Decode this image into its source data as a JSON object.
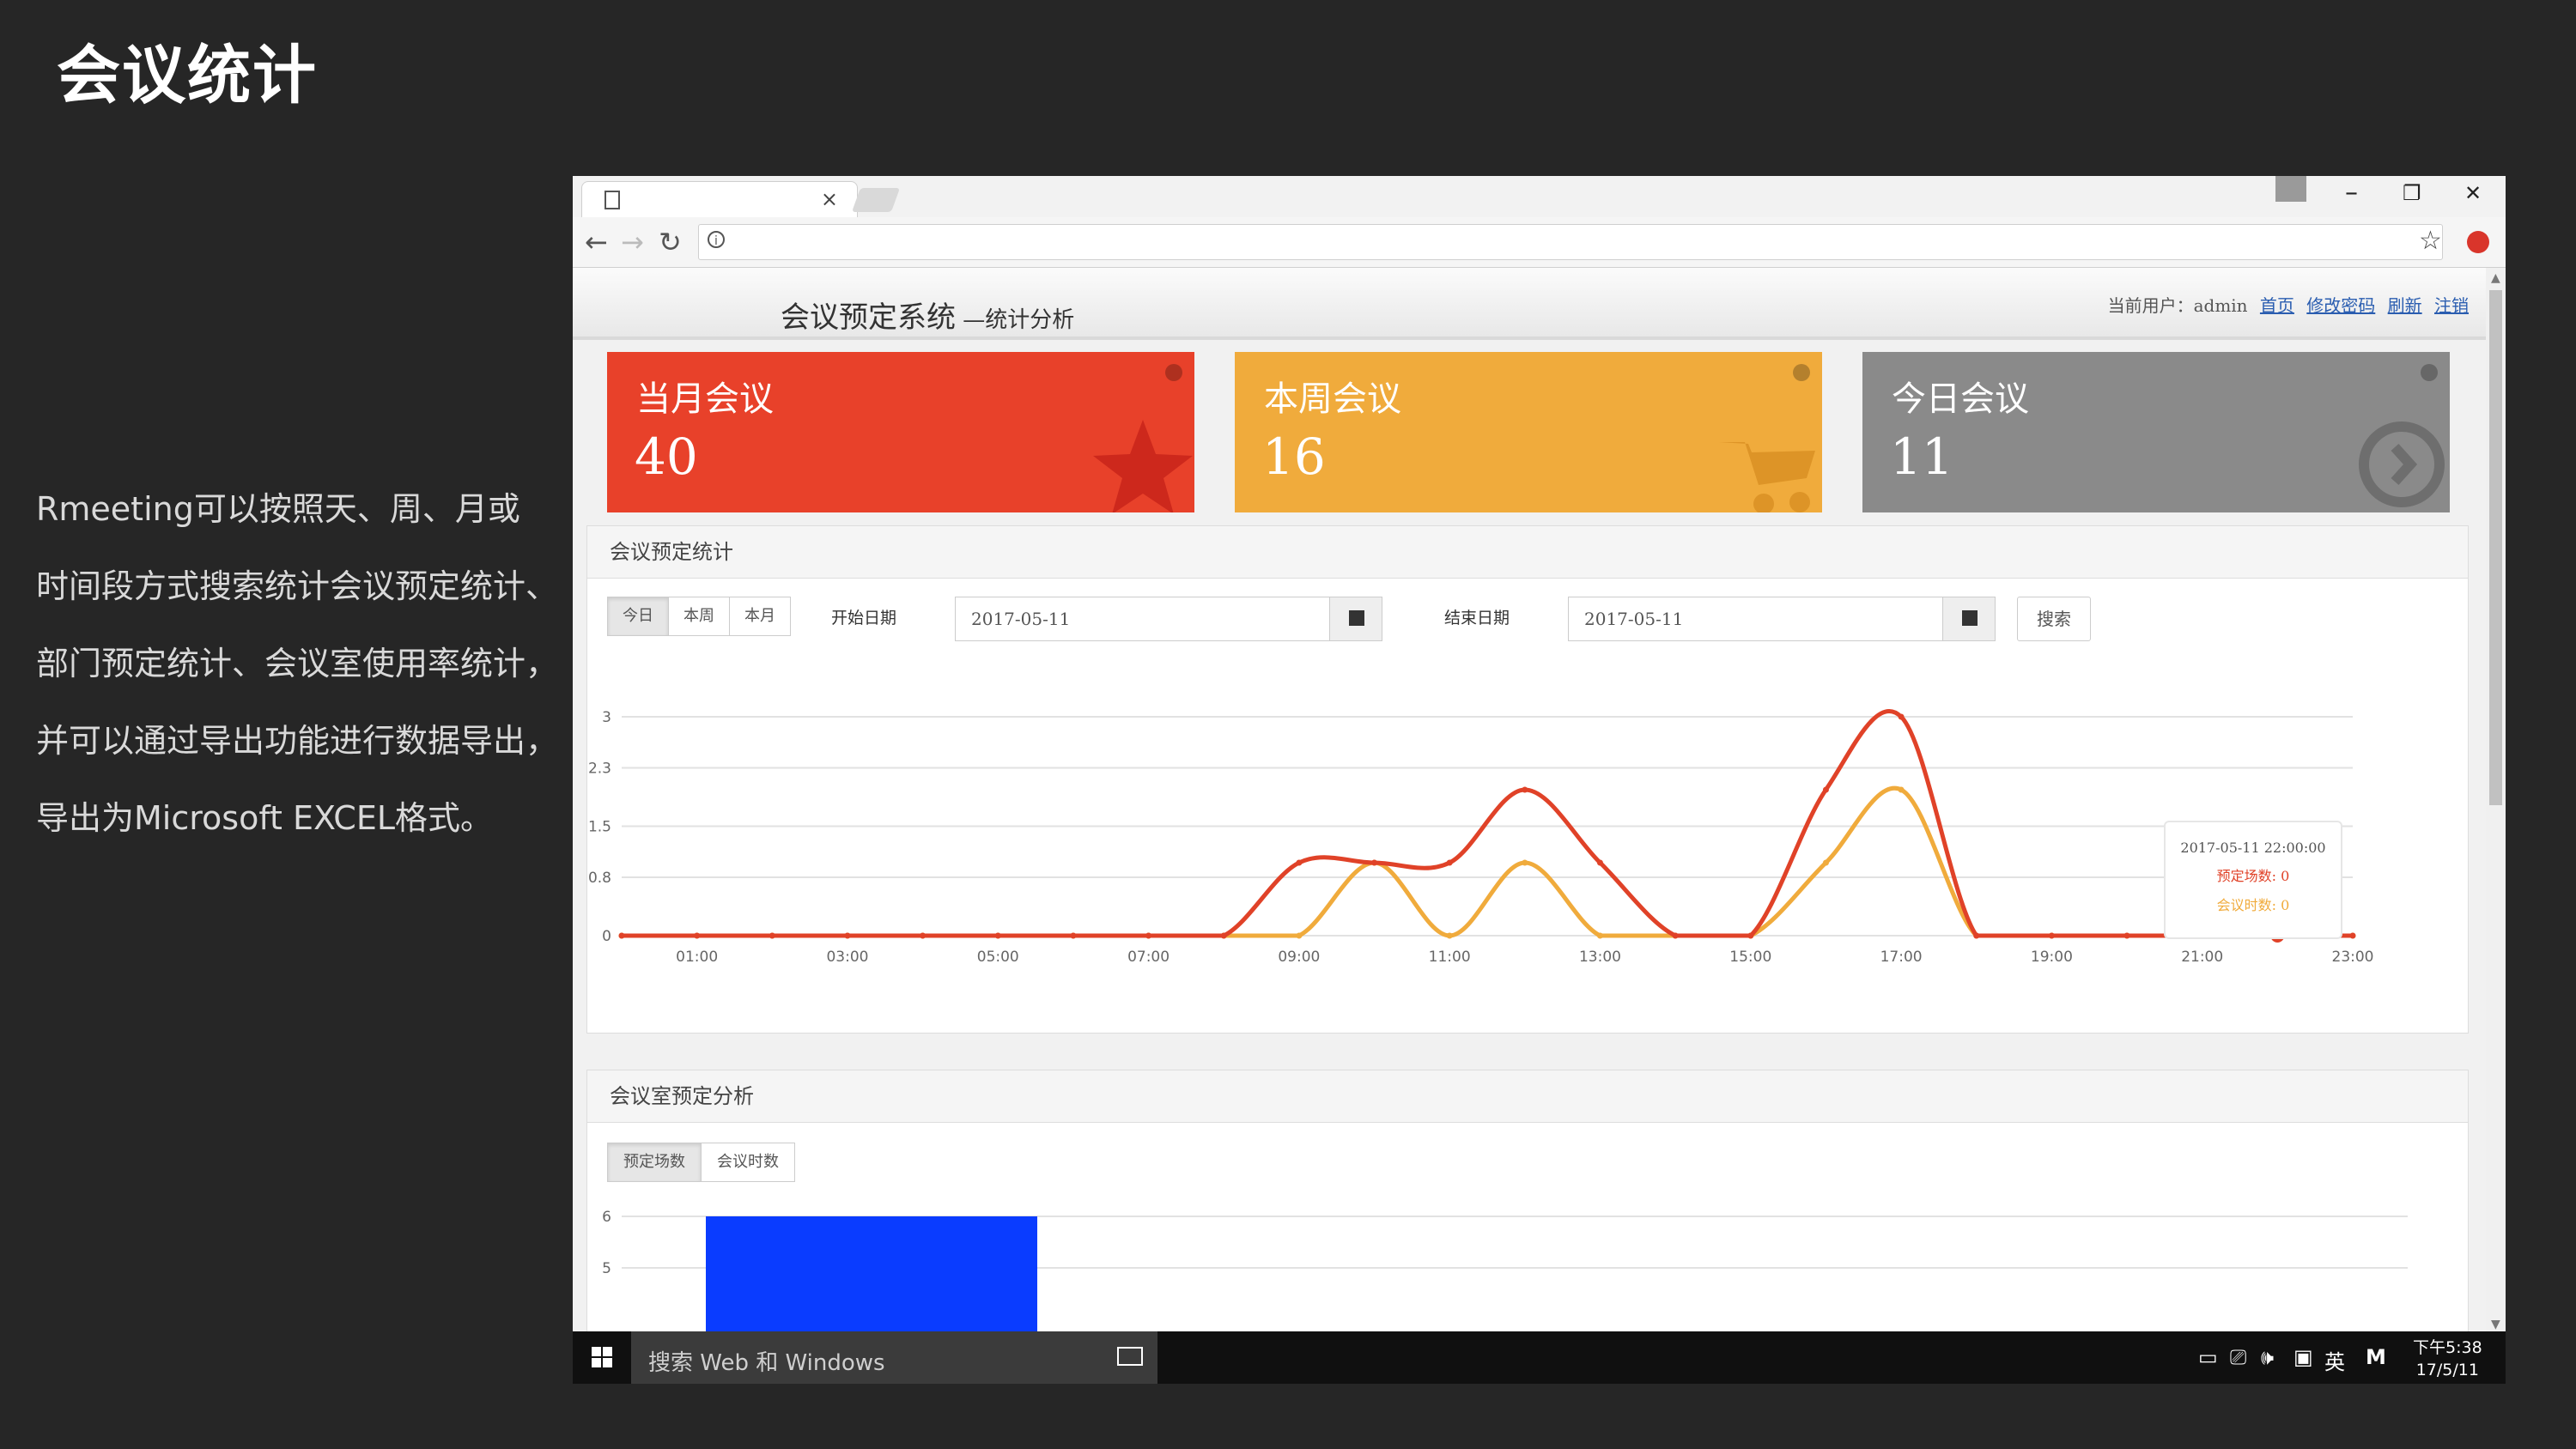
{
  "slide": {
    "title": "会议统计",
    "description": [
      "Rmeeting可以按照天、周、月或",
      "时间段方式搜索统计会议预定统计、",
      "部门预定统计、会议室使用率统计，",
      "并可以通过导出功能进行数据导出，",
      "导出为Microsoft EXCEL格式。"
    ]
  },
  "browser": {
    "tab_close": "×",
    "win_min": "–",
    "win_max": "❐",
    "win_close": "✕",
    "back": "←",
    "forward": "→",
    "reload": "↻",
    "info": "i",
    "star": "☆"
  },
  "app": {
    "system_name": "会议预定系统",
    "system_sub": " —统计分析",
    "user_label": "当前用户：admin",
    "links": [
      "首页",
      "修改密码",
      "刷新",
      "注销"
    ]
  },
  "cards": [
    {
      "title": "当月会议",
      "value": "40",
      "color": "#e8412a"
    },
    {
      "title": "本周会议",
      "value": "16",
      "color": "#f0ab3c"
    },
    {
      "title": "今日会议",
      "value": "11",
      "color": "#8a8a8a"
    }
  ],
  "stats_panel": {
    "title": "会议预定统计",
    "range_buttons": [
      "今日",
      "本周",
      "本月"
    ],
    "start_label": "开始日期",
    "start_value": "2017-05-11",
    "end_label": "结束日期",
    "end_value": "2017-05-11",
    "search_label": "搜索",
    "tooltip": {
      "time": "2017-05-11 22:00:00",
      "line1": "预定场数: 0",
      "line2": "会议时数: 0"
    }
  },
  "room_panel": {
    "title": "会议室预定分析",
    "tab_buttons": [
      "预定场数",
      "会议时数"
    ]
  },
  "taskbar": {
    "search_placeholder": "搜索 Web 和 Windows",
    "ime": "英",
    "time": "下午5:38",
    "date": "17/5/11"
  },
  "chart_data": [
    {
      "type": "line",
      "x": [
        "00:00",
        "01:00",
        "02:00",
        "03:00",
        "04:00",
        "05:00",
        "06:00",
        "07:00",
        "08:00",
        "09:00",
        "10:00",
        "11:00",
        "12:00",
        "13:00",
        "14:00",
        "15:00",
        "16:00",
        "17:00",
        "18:00",
        "19:00",
        "20:00",
        "21:00",
        "22:00",
        "23:00"
      ],
      "x_tick_labels": [
        "01:00",
        "03:00",
        "05:00",
        "07:00",
        "09:00",
        "11:00",
        "13:00",
        "15:00",
        "17:00",
        "19:00",
        "21:00",
        "23:00"
      ],
      "y_tick_labels": [
        "0",
        "0.8",
        "1.5",
        "2.3",
        "3"
      ],
      "ylim": [
        0,
        3
      ],
      "series": [
        {
          "name": "预定场数",
          "color": "#e04228",
          "values": [
            0,
            0,
            0,
            0,
            0,
            0,
            0,
            0,
            0,
            1,
            1,
            1,
            2,
            1,
            0,
            0,
            2,
            3,
            0,
            0,
            0,
            0,
            0,
            0
          ]
        },
        {
          "name": "会议时数",
          "color": "#f0ab3c",
          "values": [
            0,
            0,
            0,
            0,
            0,
            0,
            0,
            0,
            0,
            0,
            1,
            0,
            1,
            0,
            0,
            0,
            1,
            2,
            0,
            0,
            0,
            0,
            0,
            0
          ]
        }
      ],
      "grid": true
    },
    {
      "type": "bar",
      "y_tick_labels": [
        "5",
        "6"
      ],
      "bar_color": "#0a3cff",
      "values": [
        6
      ]
    }
  ]
}
